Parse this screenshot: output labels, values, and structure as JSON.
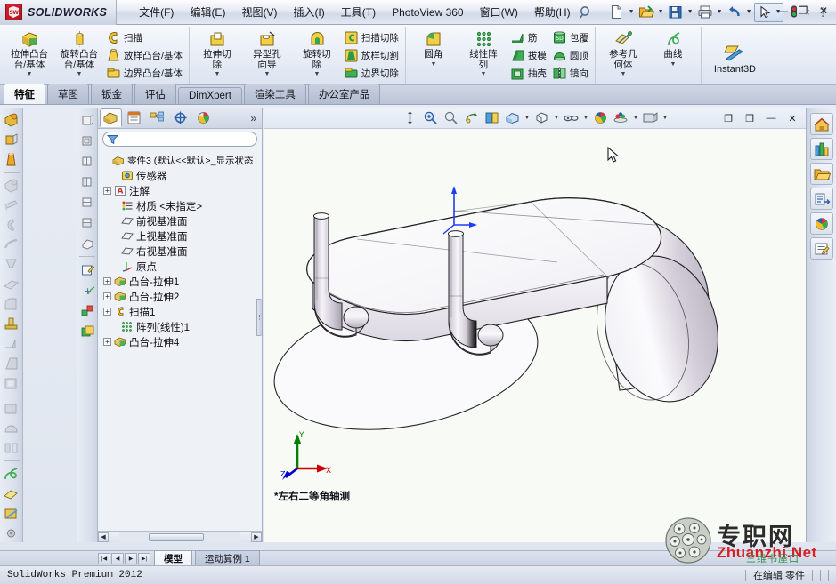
{
  "app": {
    "brand": "SOLIDWORKS",
    "logo_text": "S",
    "version_status": "SolidWorks Premium 2012"
  },
  "menubar": {
    "items": [
      {
        "label": "文件(F)",
        "name": "menu-file"
      },
      {
        "label": "编辑(E)",
        "name": "menu-edit"
      },
      {
        "label": "视图(V)",
        "name": "menu-view"
      },
      {
        "label": "插入(I)",
        "name": "menu-insert"
      },
      {
        "label": "工具(T)",
        "name": "menu-tools"
      },
      {
        "label": "PhotoView 360",
        "name": "menu-photoview"
      },
      {
        "label": "窗口(W)",
        "name": "menu-window"
      },
      {
        "label": "帮助(H)",
        "name": "menu-help"
      }
    ]
  },
  "titlebar_tools": {
    "new_label": "新建",
    "open_label": "打开",
    "save_label": "保存",
    "print_label": "打印",
    "undo_label": "撤销",
    "select_label": "选择",
    "rebuild_label": "重建模型",
    "options_label": "选项",
    "minimize": "—",
    "maximize": "❐",
    "close": "✕"
  },
  "ribbon": {
    "groups": [
      {
        "name": "boss-group",
        "big": [
          {
            "label1": "拉伸凸台",
            "label2": "台/基体",
            "name": "extruded-boss-base",
            "icon": "extrude-boss-icon"
          },
          {
            "label1": "旋转凸台",
            "label2": "台/基体",
            "name": "revolved-boss-base",
            "icon": "revolve-boss-icon"
          }
        ],
        "small": [
          {
            "label": "扫描",
            "name": "swept-boss-base",
            "icon": "sweep-icon"
          },
          {
            "label": "放样凸台/基体",
            "name": "lofted-boss-base",
            "icon": "loft-icon"
          },
          {
            "label": "边界凸台/基体",
            "name": "boundary-boss-base",
            "icon": "boundary-icon"
          }
        ]
      },
      {
        "name": "cut-group",
        "big": [
          {
            "label1": "拉伸切",
            "label2": "除",
            "name": "extruded-cut",
            "icon": "extrude-cut-icon"
          },
          {
            "label1": "异型孔",
            "label2": "向导",
            "name": "hole-wizard",
            "icon": "hole-wizard-icon"
          },
          {
            "label1": "旋转切",
            "label2": "除",
            "name": "revolved-cut",
            "icon": "revolve-cut-icon"
          }
        ],
        "small": [
          {
            "label": "扫描切除",
            "name": "swept-cut",
            "icon": "sweep-cut-icon"
          },
          {
            "label": "放样切割",
            "name": "lofted-cut",
            "icon": "loft-cut-icon"
          },
          {
            "label": "边界切除",
            "name": "boundary-cut",
            "icon": "boundary-cut-icon"
          }
        ]
      },
      {
        "name": "feature-group",
        "big": [
          {
            "label1": "圆角",
            "label2": "",
            "name": "fillet",
            "icon": "fillet-icon"
          },
          {
            "label1": "线性阵",
            "label2": "列",
            "name": "linear-pattern",
            "icon": "linear-pattern-icon"
          }
        ],
        "small": [
          {
            "label": "筋",
            "name": "rib",
            "icon": "rib-icon"
          },
          {
            "label": "拔模",
            "name": "draft",
            "icon": "draft-icon"
          },
          {
            "label": "抽壳",
            "name": "shell",
            "icon": "shell-icon"
          }
        ],
        "small2": [
          {
            "label": "包覆",
            "name": "wrap",
            "icon": "wrap-icon"
          },
          {
            "label": "圆顶",
            "name": "dome",
            "icon": "dome-icon"
          },
          {
            "label": "镜向",
            "name": "mirror",
            "icon": "mirror-icon"
          }
        ]
      },
      {
        "name": "reference-group",
        "big": [
          {
            "label1": "参考几",
            "label2": "何体",
            "name": "reference-geometry",
            "icon": "reference-geometry-icon"
          },
          {
            "label1": "曲线",
            "label2": "",
            "name": "curves",
            "icon": "curves-icon"
          }
        ]
      },
      {
        "name": "instant3d-group",
        "big": [
          {
            "label1": "Instant3D",
            "label2": "",
            "name": "instant3d",
            "icon": "instant3d-icon"
          }
        ]
      }
    ]
  },
  "command_tabs": {
    "items": [
      {
        "label": "特征",
        "name": "tab-features",
        "active": true
      },
      {
        "label": "草图",
        "name": "tab-sketch",
        "active": false
      },
      {
        "label": "钣金",
        "name": "tab-sheetmetal",
        "active": false
      },
      {
        "label": "评估",
        "name": "tab-evaluate",
        "active": false
      },
      {
        "label": "DimXpert",
        "name": "tab-dimxpert",
        "active": false
      },
      {
        "label": "渲染工具",
        "name": "tab-render-tools",
        "active": false
      },
      {
        "label": "办公室产品",
        "name": "tab-office-products",
        "active": false
      }
    ]
  },
  "feature_manager": {
    "tabs": [
      {
        "name": "tab-feature-tree",
        "icon": "feature-tree-icon",
        "active": true
      },
      {
        "name": "tab-property-manager",
        "icon": "property-manager-icon",
        "active": false
      },
      {
        "name": "tab-configuration-manager",
        "icon": "configuration-icon",
        "active": false
      },
      {
        "name": "tab-dimxpert-manager",
        "icon": "dimxpert-icon",
        "active": false
      },
      {
        "name": "tab-display-manager",
        "icon": "display-manager-icon",
        "active": false
      }
    ],
    "more_label": "»",
    "filter_placeholder": "",
    "tree": [
      {
        "label": "零件3    (默认<<默认>_显示状态",
        "name": "tree-item-part3",
        "icon": "part-icon",
        "indent": 0,
        "expand": "none"
      },
      {
        "label": "传感器",
        "name": "tree-item-sensors",
        "icon": "sensor-icon",
        "indent": 1,
        "expand": "none"
      },
      {
        "label": "注解",
        "name": "tree-item-annotations",
        "icon": "annotation-icon",
        "indent": 1,
        "expand": "plus"
      },
      {
        "label": "材质 <未指定>",
        "name": "tree-item-material",
        "icon": "material-icon",
        "indent": 1,
        "expand": "none"
      },
      {
        "label": "前视基准面",
        "name": "tree-item-front-plane",
        "icon": "plane-icon",
        "indent": 1,
        "expand": "none"
      },
      {
        "label": "上视基准面",
        "name": "tree-item-top-plane",
        "icon": "plane-icon",
        "indent": 1,
        "expand": "none"
      },
      {
        "label": "右视基准面",
        "name": "tree-item-right-plane",
        "icon": "plane-icon",
        "indent": 1,
        "expand": "none"
      },
      {
        "label": "原点",
        "name": "tree-item-origin",
        "icon": "origin-icon",
        "indent": 1,
        "expand": "none"
      },
      {
        "label": "凸台-拉伸1",
        "name": "tree-item-boss-extrude1",
        "icon": "extrude-icon",
        "indent": 1,
        "expand": "plus"
      },
      {
        "label": "凸台-拉伸2",
        "name": "tree-item-boss-extrude2",
        "icon": "extrude-icon",
        "indent": 1,
        "expand": "plus"
      },
      {
        "label": "扫描1",
        "name": "tree-item-sweep1",
        "icon": "sweep-tree-icon",
        "indent": 1,
        "expand": "plus"
      },
      {
        "label": "阵列(线性)1",
        "name": "tree-item-linear-pattern1",
        "icon": "pattern-icon",
        "indent": 1,
        "expand": "none"
      },
      {
        "label": "凸台-拉伸4",
        "name": "tree-item-boss-extrude4",
        "icon": "extrude-icon",
        "indent": 1,
        "expand": "plus"
      }
    ]
  },
  "viewport": {
    "view_label": "*左右二等角轴测",
    "axis": {
      "x": "X",
      "y": "Y",
      "z": "Z"
    },
    "colors": {
      "background": "#f8faf6",
      "x_axis": "#cc0000",
      "y_axis": "#008000",
      "z_axis": "#0000cc",
      "origin": "#1e3cf0",
      "model_light": "#f2f0f4",
      "model_mid": "#c8c3cf",
      "model_edge": "#232327"
    },
    "view_tools": [
      {
        "name": "zoom-to-fit-icon",
        "label": "整屏显示"
      },
      {
        "name": "zoom-to-area-icon",
        "label": "局部放大"
      },
      {
        "name": "zoom-in-out-icon",
        "label": "动态放大"
      },
      {
        "name": "rotate-view-icon",
        "label": "旋转视图"
      },
      {
        "name": "section-view-icon",
        "label": "剖面视图"
      },
      {
        "name": "view-orientation-icon",
        "label": "视图定向"
      },
      {
        "name": "display-style-icon",
        "label": "显示样式"
      },
      {
        "name": "hide-show-icon",
        "label": "隐藏/显示项目"
      },
      {
        "name": "appearance-icon",
        "label": "编辑外观"
      },
      {
        "name": "scene-icon",
        "label": "应用布景"
      },
      {
        "name": "view-settings-icon",
        "label": "视图设定"
      }
    ],
    "window_buttons": [
      {
        "name": "restore-doc-icon",
        "label": "❐"
      },
      {
        "name": "tile-doc-icon",
        "label": "❒"
      },
      {
        "name": "minimize-doc-icon",
        "label": "—"
      },
      {
        "name": "close-doc-icon",
        "label": "✕"
      }
    ]
  },
  "task_pane": [
    {
      "name": "task-pane-resources",
      "icon": "home-icon",
      "label": "SolidWorks 资源"
    },
    {
      "name": "task-pane-design-library",
      "icon": "design-library-icon",
      "label": "设计库"
    },
    {
      "name": "task-pane-file-explorer",
      "icon": "folder-icon",
      "label": "文件探索器"
    },
    {
      "name": "task-pane-search",
      "icon": "search-icon",
      "label": "SolidWorks 搜索"
    },
    {
      "name": "task-pane-appearances",
      "icon": "appearances-icon",
      "label": "外观布景和贴图"
    },
    {
      "name": "task-pane-custom",
      "icon": "custom-properties-icon",
      "label": "自定义属性"
    }
  ],
  "bottom_tabs": {
    "nav": [
      "|◀",
      "◀",
      "▶",
      "▶|"
    ],
    "items": [
      {
        "label": "模型",
        "name": "bottom-tab-model",
        "active": true
      },
      {
        "label": "运动算例 1",
        "name": "bottom-tab-motion-study",
        "active": false
      }
    ]
  },
  "statusbar": {
    "left": "SolidWorks Premium 2012",
    "editing": "在编辑  零件"
  },
  "watermark": {
    "cn": "专职网",
    "en": "Zhuanzhi.Net",
    "sub": "三维书屋口"
  }
}
